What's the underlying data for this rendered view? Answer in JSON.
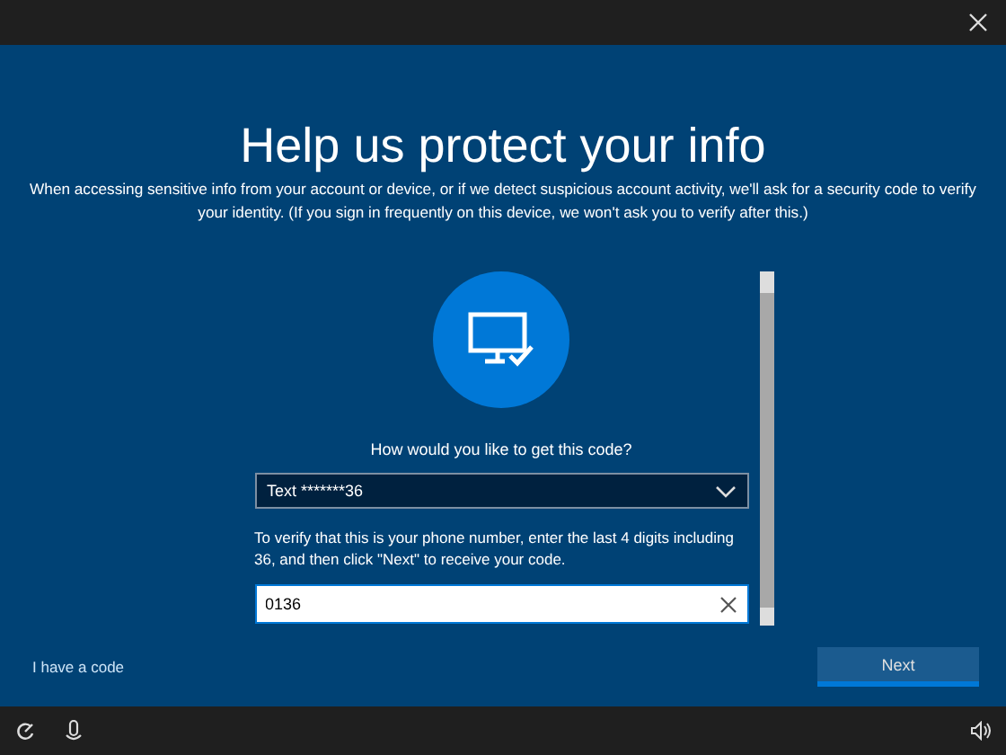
{
  "title": "Help us protect your info",
  "description": "When accessing sensitive info from your account or device, or if we detect suspicious account activity, we'll ask for a security code to verify your identity. (If you sign in frequently on this device, we won't ask you to verify after this.)",
  "question": "How would you like to get this code?",
  "method_dropdown": {
    "value": "Text *******36"
  },
  "instruction": "To verify that this is your phone number, enter the last 4 digits including 36, and then click \"Next\" to receive your code.",
  "digits_field": {
    "value": "0136"
  },
  "link": "I have a code",
  "next_button": {
    "label": "Next"
  }
}
